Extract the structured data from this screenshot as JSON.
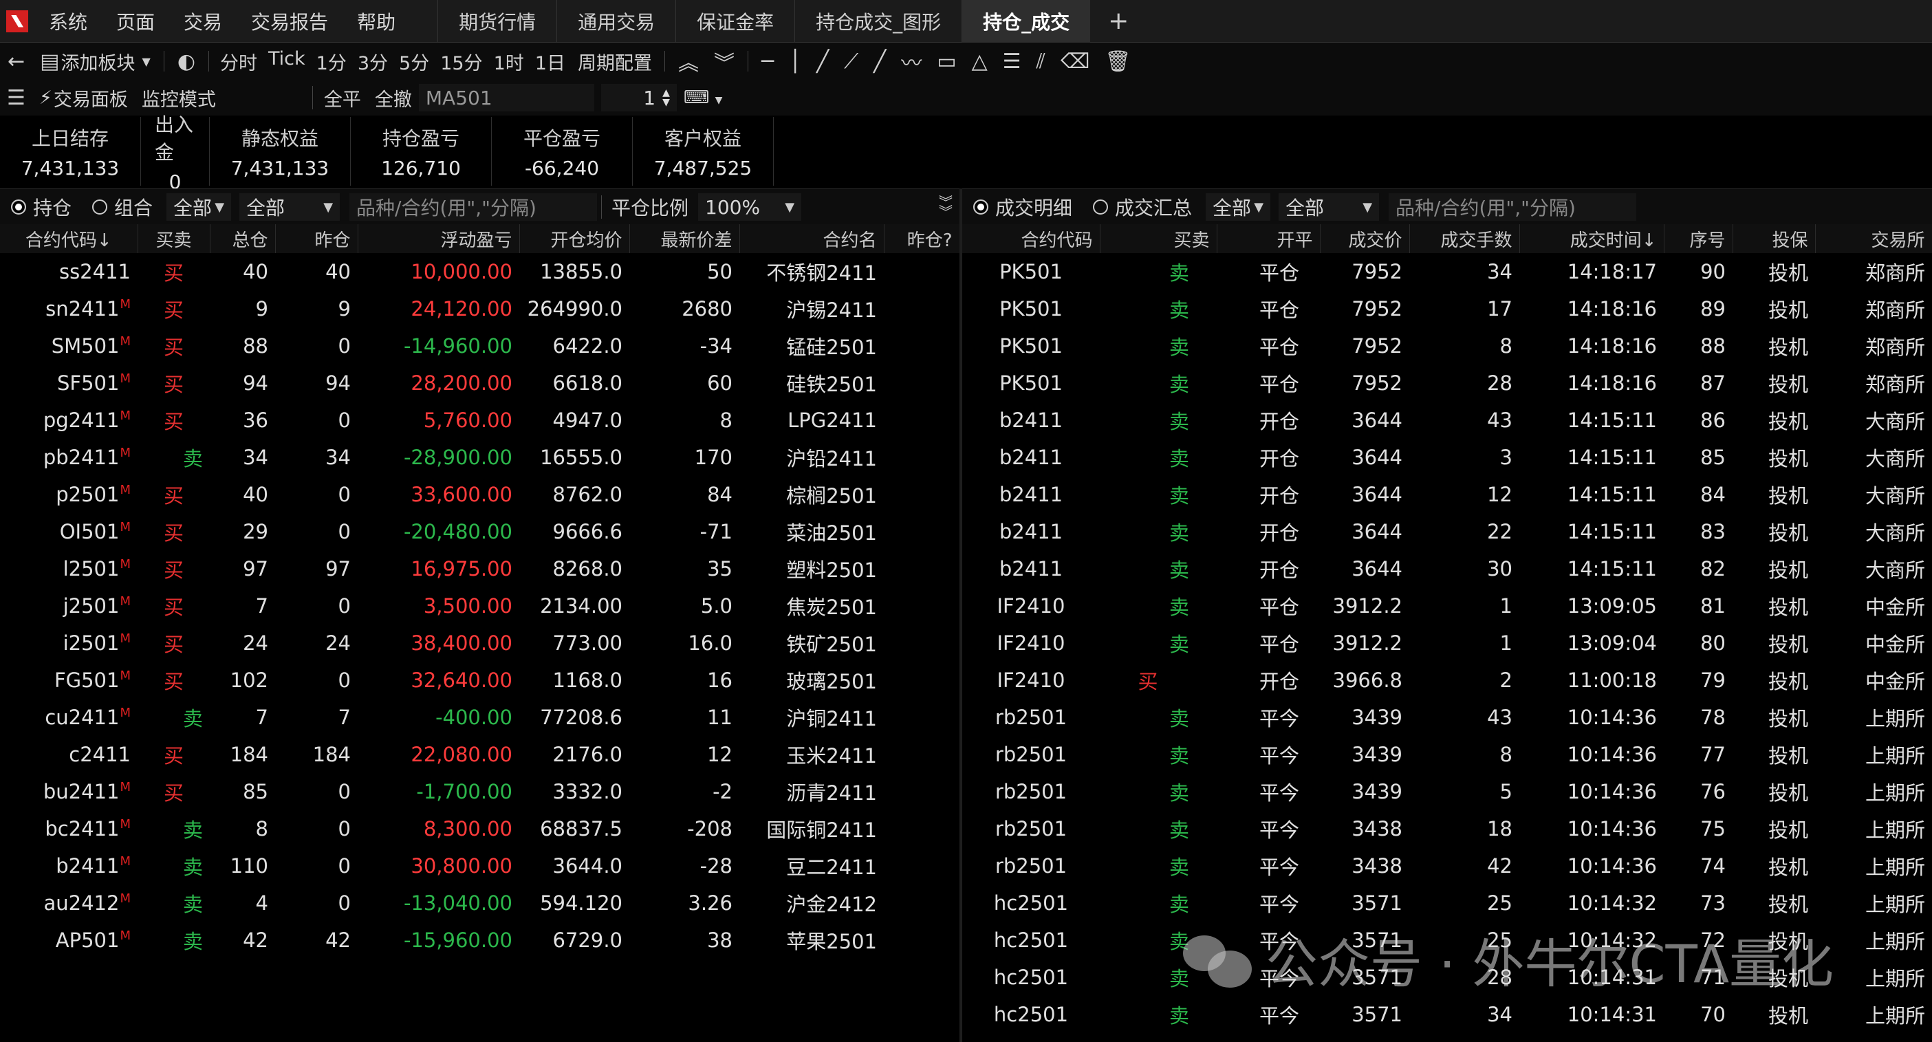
{
  "menu": {
    "items": [
      "系统",
      "页面",
      "交易",
      "交易报告",
      "帮助"
    ],
    "tabs": [
      {
        "label": "期货行情",
        "active": false
      },
      {
        "label": "通用交易",
        "active": false
      },
      {
        "label": "保证金率",
        "active": false
      },
      {
        "label": "持仓成交_图形",
        "active": false
      },
      {
        "label": "持仓_成交",
        "active": true
      }
    ],
    "add_tab": "+"
  },
  "toolbar": {
    "add_block": "添加板块",
    "periods": [
      "分时",
      "Tick",
      "1分",
      "3分",
      "5分",
      "15分",
      "1时",
      "1日"
    ],
    "period_config": "周期配置"
  },
  "toolbar2": {
    "trade_panel": "交易面板",
    "monitor_mode": "监控模式",
    "close_all": "全平",
    "cancel_all": "全撤",
    "contract": "MA501",
    "qty": "1"
  },
  "account": [
    {
      "label": "上日结存",
      "value": "7,431,133"
    },
    {
      "label": "出入金",
      "value": "0"
    },
    {
      "label": "静态权益",
      "value": "7,431,133"
    },
    {
      "label": "持仓盈亏",
      "value": "126,710"
    },
    {
      "label": "平仓盈亏",
      "value": "-66,240"
    },
    {
      "label": "客户权益",
      "value": "7,487,525"
    }
  ],
  "positions": {
    "radio_hold": "持仓",
    "radio_combo": "组合",
    "filter1": "全部",
    "filter2": "全部",
    "search_placeholder": "品种/合约(用\",\"分隔)",
    "ratio_label": "平仓比例",
    "ratio_value": "100%",
    "columns": [
      "合约代码↓",
      "买卖",
      "总仓",
      "昨仓",
      "浮动盈亏",
      "开仓均价",
      "最新价差",
      "合约名",
      "昨仓?"
    ],
    "rows": [
      {
        "code": "ss2411",
        "m": "",
        "side": "买",
        "total": "40",
        "yest": "40",
        "pnl": "10,000.00",
        "avg": "13855.0",
        "diff": "50",
        "name": "不锈钢2411"
      },
      {
        "code": "sn2411",
        "m": "M",
        "side": "买",
        "total": "9",
        "yest": "9",
        "pnl": "24,120.00",
        "avg": "264990.0",
        "diff": "2680",
        "name": "沪锡2411"
      },
      {
        "code": "SM501",
        "m": "M",
        "side": "买",
        "total": "88",
        "yest": "0",
        "pnl": "-14,960.00",
        "avg": "6422.0",
        "diff": "-34",
        "name": "锰硅2501"
      },
      {
        "code": "SF501",
        "m": "M",
        "side": "买",
        "total": "94",
        "yest": "94",
        "pnl": "28,200.00",
        "avg": "6618.0",
        "diff": "60",
        "name": "硅铁2501"
      },
      {
        "code": "pg2411",
        "m": "M",
        "side": "买",
        "total": "36",
        "yest": "0",
        "pnl": "5,760.00",
        "avg": "4947.0",
        "diff": "8",
        "name": "LPG2411"
      },
      {
        "code": "pb2411",
        "m": "M",
        "side": "卖",
        "total": "34",
        "yest": "34",
        "pnl": "-28,900.00",
        "avg": "16555.0",
        "diff": "170",
        "name": "沪铅2411"
      },
      {
        "code": "p2501",
        "m": "M",
        "side": "买",
        "total": "40",
        "yest": "0",
        "pnl": "33,600.00",
        "avg": "8762.0",
        "diff": "84",
        "name": "棕榈2501"
      },
      {
        "code": "OI501",
        "m": "M",
        "side": "买",
        "total": "29",
        "yest": "0",
        "pnl": "-20,480.00",
        "avg": "9666.6",
        "diff": "-71",
        "name": "菜油2501"
      },
      {
        "code": "l2501",
        "m": "M",
        "side": "买",
        "total": "97",
        "yest": "97",
        "pnl": "16,975.00",
        "avg": "8268.0",
        "diff": "35",
        "name": "塑料2501"
      },
      {
        "code": "j2501",
        "m": "M",
        "side": "买",
        "total": "7",
        "yest": "0",
        "pnl": "3,500.00",
        "avg": "2134.00",
        "diff": "5.0",
        "name": "焦炭2501"
      },
      {
        "code": "i2501",
        "m": "M",
        "side": "买",
        "total": "24",
        "yest": "24",
        "pnl": "38,400.00",
        "avg": "773.00",
        "diff": "16.0",
        "name": "铁矿2501"
      },
      {
        "code": "FG501",
        "m": "M",
        "side": "买",
        "total": "102",
        "yest": "0",
        "pnl": "32,640.00",
        "avg": "1168.0",
        "diff": "16",
        "name": "玻璃2501"
      },
      {
        "code": "cu2411",
        "m": "M",
        "side": "卖",
        "total": "7",
        "yest": "7",
        "pnl": "-400.00",
        "avg": "77208.6",
        "diff": "11",
        "name": "沪铜2411"
      },
      {
        "code": "c2411",
        "m": "",
        "side": "买",
        "total": "184",
        "yest": "184",
        "pnl": "22,080.00",
        "avg": "2176.0",
        "diff": "12",
        "name": "玉米2411"
      },
      {
        "code": "bu2411",
        "m": "M",
        "side": "买",
        "total": "85",
        "yest": "0",
        "pnl": "-1,700.00",
        "avg": "3332.0",
        "diff": "-2",
        "name": "沥青2411"
      },
      {
        "code": "bc2411",
        "m": "M",
        "side": "卖",
        "total": "8",
        "yest": "0",
        "pnl": "8,300.00",
        "avg": "68837.5",
        "diff": "-208",
        "name": "国际铜2411"
      },
      {
        "code": "b2411",
        "m": "M",
        "side": "卖",
        "total": "110",
        "yest": "0",
        "pnl": "30,800.00",
        "avg": "3644.0",
        "diff": "-28",
        "name": "豆二2411"
      },
      {
        "code": "au2412",
        "m": "M",
        "side": "卖",
        "total": "4",
        "yest": "0",
        "pnl": "-13,040.00",
        "avg": "594.120",
        "diff": "3.26",
        "name": "沪金2412"
      },
      {
        "code": "AP501",
        "m": "M",
        "side": "卖",
        "total": "42",
        "yest": "42",
        "pnl": "-15,960.00",
        "avg": "6729.0",
        "diff": "38",
        "name": "苹果2501"
      }
    ]
  },
  "trades": {
    "radio_detail": "成交明细",
    "radio_summary": "成交汇总",
    "filter1": "全部",
    "filter2": "全部",
    "search_placeholder": "品种/合约(用\",\"分隔)",
    "columns": [
      "合约代码",
      "买卖",
      "开平",
      "成交价",
      "成交手数",
      "成交时间↓",
      "序号",
      "投保",
      "交易所"
    ],
    "rows": [
      {
        "code": "PK501",
        "side": "卖",
        "oc": "平仓",
        "price": "7952",
        "qty": "34",
        "time": "14:18:17",
        "seq": "90",
        "hedge": "投机",
        "exch": "郑商所"
      },
      {
        "code": "PK501",
        "side": "卖",
        "oc": "平仓",
        "price": "7952",
        "qty": "17",
        "time": "14:18:16",
        "seq": "89",
        "hedge": "投机",
        "exch": "郑商所"
      },
      {
        "code": "PK501",
        "side": "卖",
        "oc": "平仓",
        "price": "7952",
        "qty": "8",
        "time": "14:18:16",
        "seq": "88",
        "hedge": "投机",
        "exch": "郑商所"
      },
      {
        "code": "PK501",
        "side": "卖",
        "oc": "平仓",
        "price": "7952",
        "qty": "28",
        "time": "14:18:16",
        "seq": "87",
        "hedge": "投机",
        "exch": "郑商所"
      },
      {
        "code": "b2411",
        "side": "卖",
        "oc": "开仓",
        "price": "3644",
        "qty": "43",
        "time": "14:15:11",
        "seq": "86",
        "hedge": "投机",
        "exch": "大商所"
      },
      {
        "code": "b2411",
        "side": "卖",
        "oc": "开仓",
        "price": "3644",
        "qty": "3",
        "time": "14:15:11",
        "seq": "85",
        "hedge": "投机",
        "exch": "大商所"
      },
      {
        "code": "b2411",
        "side": "卖",
        "oc": "开仓",
        "price": "3644",
        "qty": "12",
        "time": "14:15:11",
        "seq": "84",
        "hedge": "投机",
        "exch": "大商所"
      },
      {
        "code": "b2411",
        "side": "卖",
        "oc": "开仓",
        "price": "3644",
        "qty": "22",
        "time": "14:15:11",
        "seq": "83",
        "hedge": "投机",
        "exch": "大商所"
      },
      {
        "code": "b2411",
        "side": "卖",
        "oc": "开仓",
        "price": "3644",
        "qty": "30",
        "time": "14:15:11",
        "seq": "82",
        "hedge": "投机",
        "exch": "大商所"
      },
      {
        "code": "IF2410",
        "side": "卖",
        "oc": "平仓",
        "price": "3912.2",
        "qty": "1",
        "time": "13:09:05",
        "seq": "81",
        "hedge": "投机",
        "exch": "中金所"
      },
      {
        "code": "IF2410",
        "side": "卖",
        "oc": "平仓",
        "price": "3912.2",
        "qty": "1",
        "time": "13:09:04",
        "seq": "80",
        "hedge": "投机",
        "exch": "中金所"
      },
      {
        "code": "IF2410",
        "side": "买",
        "oc": "开仓",
        "price": "3966.8",
        "qty": "2",
        "time": "11:00:18",
        "seq": "79",
        "hedge": "投机",
        "exch": "中金所"
      },
      {
        "code": "rb2501",
        "side": "卖",
        "oc": "平今",
        "price": "3439",
        "qty": "43",
        "time": "10:14:36",
        "seq": "78",
        "hedge": "投机",
        "exch": "上期所"
      },
      {
        "code": "rb2501",
        "side": "卖",
        "oc": "平今",
        "price": "3439",
        "qty": "8",
        "time": "10:14:36",
        "seq": "77",
        "hedge": "投机",
        "exch": "上期所"
      },
      {
        "code": "rb2501",
        "side": "卖",
        "oc": "平今",
        "price": "3439",
        "qty": "5",
        "time": "10:14:36",
        "seq": "76",
        "hedge": "投机",
        "exch": "上期所"
      },
      {
        "code": "rb2501",
        "side": "卖",
        "oc": "平今",
        "price": "3438",
        "qty": "18",
        "time": "10:14:36",
        "seq": "75",
        "hedge": "投机",
        "exch": "上期所"
      },
      {
        "code": "rb2501",
        "side": "卖",
        "oc": "平今",
        "price": "3438",
        "qty": "42",
        "time": "10:14:36",
        "seq": "74",
        "hedge": "投机",
        "exch": "上期所"
      },
      {
        "code": "hc2501",
        "side": "卖",
        "oc": "平今",
        "price": "3571",
        "qty": "25",
        "time": "10:14:32",
        "seq": "73",
        "hedge": "投机",
        "exch": "上期所"
      },
      {
        "code": "hc2501",
        "side": "卖",
        "oc": "平今",
        "price": "3571",
        "qty": "25",
        "time": "10:14:32",
        "seq": "72",
        "hedge": "投机",
        "exch": "上期所"
      },
      {
        "code": "hc2501",
        "side": "卖",
        "oc": "平今",
        "price": "3571",
        "qty": "28",
        "time": "10:14:31",
        "seq": "71",
        "hedge": "投机",
        "exch": "上期所"
      },
      {
        "code": "hc2501",
        "side": "卖",
        "oc": "平今",
        "price": "3571",
        "qty": "34",
        "time": "10:14:31",
        "seq": "70",
        "hedge": "投机",
        "exch": "上期所"
      }
    ]
  },
  "watermark": "公众号 · 外牛尔CTA量化",
  "colors": {
    "buy": "#e53030",
    "sell": "#2cb84c",
    "profit": "#ff3b3b",
    "loss": "#2cb84c",
    "marker": "#e02020"
  }
}
